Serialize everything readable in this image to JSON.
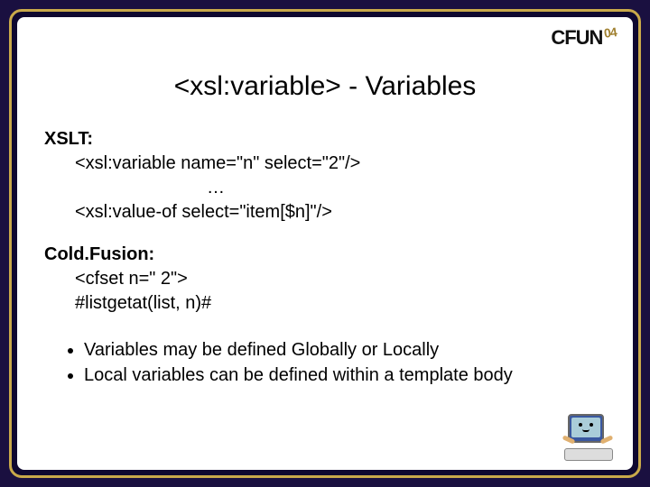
{
  "logo": {
    "text_c": "C",
    "text_fun": "FUN",
    "year": "04"
  },
  "title": "<xsl:variable> - Variables",
  "xslt": {
    "label": "XSLT:",
    "line1": "<xsl:variable name=\"n\" select=\"2\"/>",
    "ellipsis": "…",
    "line2": "<xsl:value-of select=\"item[$n]\"/>"
  },
  "cf": {
    "label": "Cold.Fusion:",
    "line1": "<cfset n=\" 2\">",
    "line2": "#listgetat(list, n)#"
  },
  "bullets": [
    "Variables may be defined Globally or Locally",
    "Local variables can be defined within a template body"
  ]
}
